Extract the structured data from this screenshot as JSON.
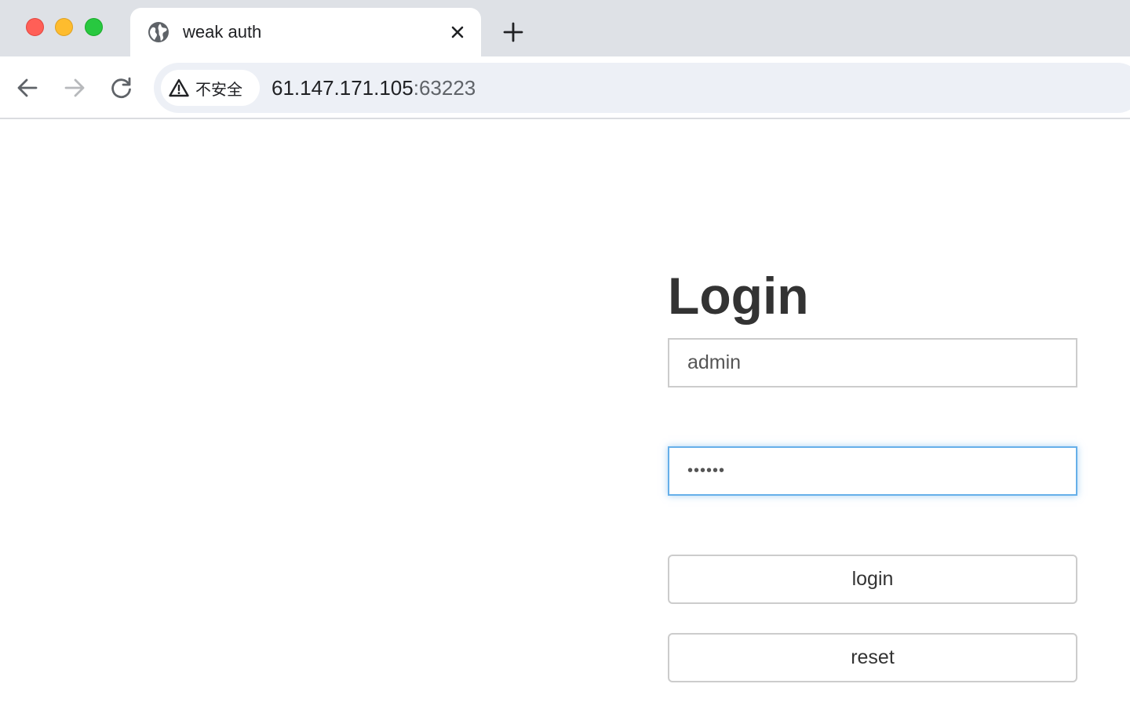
{
  "browser": {
    "tab": {
      "title": "weak auth",
      "favicon": "globe-icon"
    },
    "omnibox": {
      "security_label": "不安全",
      "security_icon": "warning-icon",
      "url_host": "61.147.171.105",
      "url_port": ":63223"
    },
    "icons": {
      "close": "close-icon",
      "new_tab": "plus-icon",
      "back": "back-arrow-icon",
      "forward": "forward-arrow-icon",
      "reload": "reload-icon"
    }
  },
  "login_form": {
    "title": "Login",
    "username_value": "admin",
    "password_value": "••••••",
    "login_button": "login",
    "reset_button": "reset"
  },
  "colors": {
    "focus_border": "#66afe9",
    "title_text": "#333333",
    "tabstrip_bg": "#dee1e6",
    "omnibox_bg": "#edf0f6"
  }
}
